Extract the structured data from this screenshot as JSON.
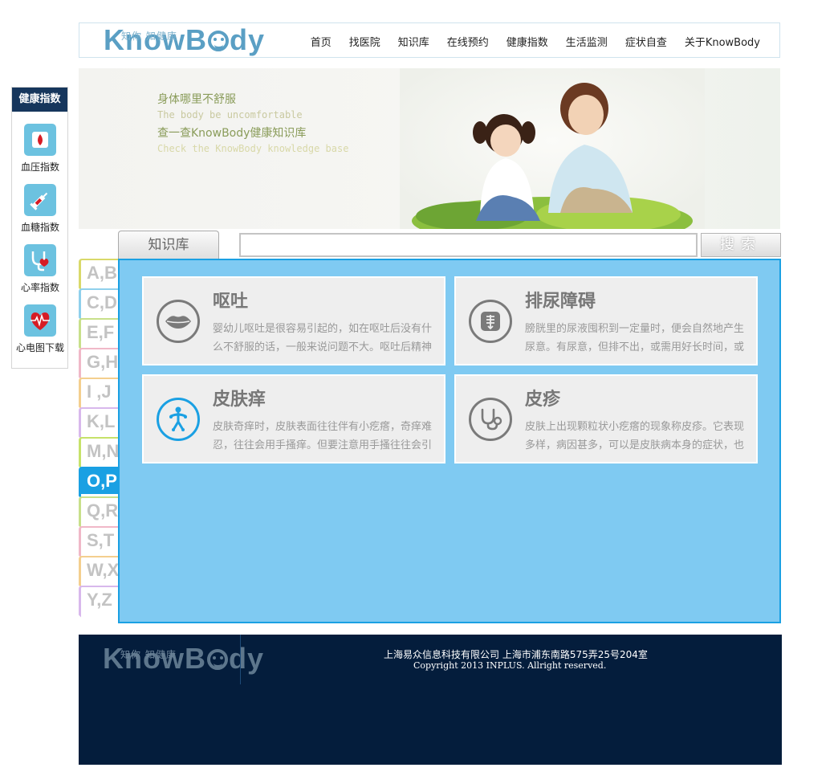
{
  "header": {
    "logo_small": "知你 知健康",
    "logo_big_left": "Kn",
    "logo_big_mid": "w",
    "logo_big_b": "B",
    "logo_big_right": "dy",
    "nav": [
      "首页",
      "找医院",
      "知识库",
      "在线预约",
      "健康指数",
      "生活监测",
      "症状自查",
      "关于KnowBody"
    ]
  },
  "sidebar": {
    "title": "健康指数",
    "items": [
      {
        "label": "血压指数",
        "icon": "blood-drop-icon"
      },
      {
        "label": "血糖指数",
        "icon": "syringe-icon"
      },
      {
        "label": "心率指数",
        "icon": "stethoscope-heart-icon"
      },
      {
        "label": "心电图下载",
        "icon": "ecg-heart-icon"
      }
    ]
  },
  "banner": {
    "line1": "身体哪里不舒服",
    "line2": "The body be uncomfortable",
    "line3": "查一查KnowBody健康知识库",
    "line4": "Check the KnowBody knowledge base"
  },
  "knowledge": {
    "tab_label": "知识库",
    "search_placeholder": "",
    "search_button": "搜索",
    "letters": [
      "A,B",
      "C,D",
      "E,F",
      "G,H",
      "I ,J",
      "K,L",
      "M,N",
      "O,P",
      "Q,R",
      "S,T",
      "W,X",
      "Y,Z"
    ],
    "active_letter": "O,P",
    "letter_colors": [
      "#d9d96a",
      "#8fd0ec",
      "#c8e08a",
      "#f0b8c8",
      "#f4cf8e",
      "#d8b8ec",
      "#c6e26a",
      "#1aa0e3",
      "#c8e08a",
      "#f0b8c8",
      "#f4cf8e",
      "#d8b8ec"
    ],
    "cards": [
      {
        "title": "呕吐",
        "desc": "婴幼儿呕吐是很容易引起的，如在呕吐后没有什么不舒服的话，一般来说问题不大。呕吐后精神",
        "icon": "lips-icon"
      },
      {
        "title": "排尿障碍",
        "desc": "膀胱里的尿液囤积到一定量时，便会自然地产生尿意。有尿意，但排不出，或需用好长时间，或",
        "icon": "bladder-icon"
      },
      {
        "title": "皮肤痒",
        "desc": "皮肤奇痒时，皮肤表面往往伴有小疙瘩，奇痒难忍，往往会用手搔痒。但要注意用手搔往往会引",
        "icon": "body-figure-icon"
      },
      {
        "title": "皮疹",
        "desc": "皮肤上出现颗粒状小疙瘩的现象称皮疹。它表现多样，病因甚多，可以是皮肤病本身的症状，也",
        "icon": "stethoscope-icon"
      }
    ]
  },
  "footer": {
    "company": "上海易众信息科技有限公司 上海市浦东南路575弄25号204室",
    "copyright": "Copyright 2013 INPLUS. Allright reserved."
  }
}
